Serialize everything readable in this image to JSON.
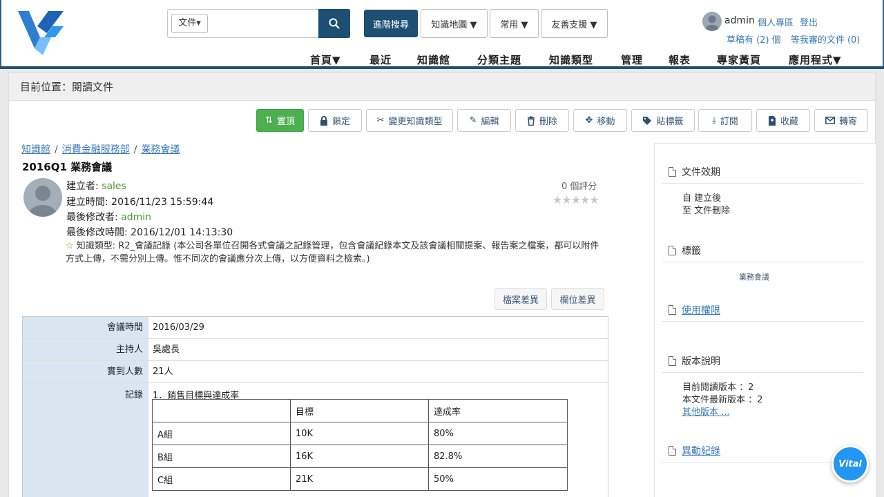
{
  "header": {
    "search": {
      "type_label": "文件▾",
      "placeholder": ""
    },
    "advanced_search_label": "進階搜尋",
    "dropdowns": [
      "知識地圖 ▼",
      "常用 ▼",
      "友善支援 ▼"
    ],
    "user": {
      "name": "admin",
      "personal_link": "個人專區",
      "logout_link": "登出",
      "drafts_link": "草稿有 (2) 個",
      "pending_link": "等我審的文件 (0)"
    },
    "nav": [
      "首頁▼",
      "最近",
      "知識館",
      "分類主題",
      "知識類型",
      "管理",
      "報表",
      "專家黃頁",
      "應用程式▼"
    ]
  },
  "panel": {
    "location": "目前位置：閱讀文件",
    "toolbar": {
      "top": "置頂",
      "lock": "鎖定",
      "change_type": "變更知識類型",
      "edit": "編輯",
      "delete": "刪除",
      "move": "移動",
      "tag": "貼標籤",
      "subscribe": "訂閱",
      "favorite": "收藏",
      "forward": "轉寄"
    },
    "breadcrumb": [
      "知識館",
      "消費金融服務部",
      "業務會議"
    ],
    "doc_title": "2016Q1 業務會議",
    "meta": {
      "creator_label": "建立者: ",
      "creator": "sales",
      "created_label": "建立時間: 2016/11/23 15:59:44",
      "modifier_label": "最後修改者: ",
      "modifier": "admin",
      "modified_label": "最後修改時間: 2016/12/01 14:13:30",
      "knowledge_type": "知識類型: R2_會議記錄 (本公司各單位召開各式會議之記錄管理，包含會議紀錄本文及該會議相關提案、報告案之檔案，都可以附件方式上傳，不需分別上傳。惟不同次的會議應分次上傳，以方便資料之檢索。)"
    },
    "rating": {
      "text": "0 個評分",
      "stars": 0,
      "max": 5
    },
    "diff_buttons": {
      "file_diff": "檔案差異",
      "field_diff": "欄位差異"
    },
    "fields": [
      {
        "label": "會議時間",
        "value": "2016/03/29"
      },
      {
        "label": "主持人",
        "value": "吳處長"
      },
      {
        "label": "實到人數",
        "value": "21人"
      },
      {
        "label": "記錄",
        "value": "1．銷售目標與達成率"
      }
    ],
    "record_table": {
      "headers": [
        "",
        "目標",
        "達成率"
      ],
      "rows": [
        [
          "A組",
          "10K",
          "80%"
        ],
        [
          "B組",
          "16K",
          "82.8%"
        ],
        [
          "C組",
          "21K",
          "50%"
        ]
      ]
    }
  },
  "sidebar": {
    "validity_title": "文件效期",
    "validity_from": "自  建立後",
    "validity_to": "至  文件刪除",
    "tags_title": "標籤",
    "tag_value": "業務會議",
    "permission_title": "使用權限",
    "version_title": "版本說明",
    "version_current": "目前閱讀版本 ：2",
    "version_latest": "本文件最新版本 ：2",
    "version_other": "其他版本 ...",
    "changes_title": "異動紀錄"
  },
  "widget": {
    "label": "Vital"
  },
  "colors": {
    "primary": "#1d4f73",
    "link": "#3a7ab8",
    "green": "#4caf50",
    "label_bg": "#d9e6f2"
  }
}
